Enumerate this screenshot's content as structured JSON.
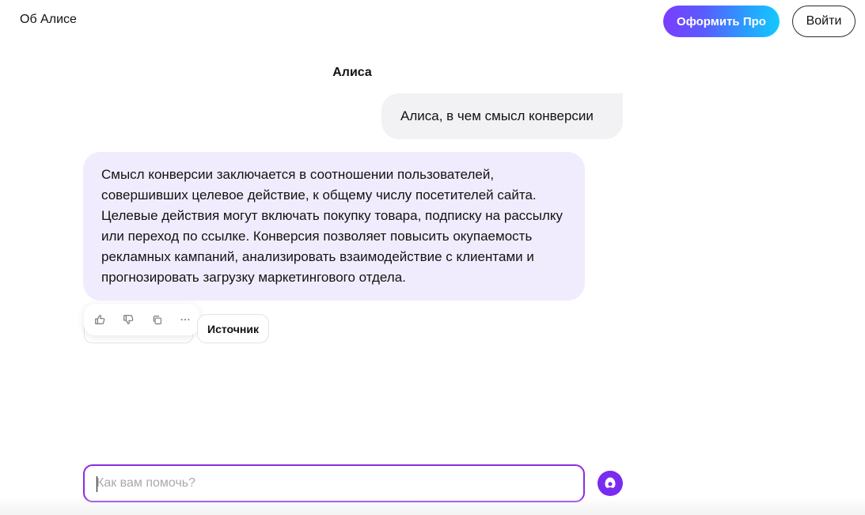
{
  "header": {
    "about_label": "Об Алисе",
    "pro_label": "Оформить Про",
    "login_label": "Войти"
  },
  "chat": {
    "title": "Алиса",
    "user_message": "Алиса, в чем смысл конверсии",
    "assistant_message": "Смысл конверсии заключается в соотношении пользователей, совершивших целевое действие, к общему числу посетителей сайта. Целевые действия могут включать покупку товара, подписку на рассылку или переход по ссылке. Конверсия позволяет повысить окупаемость рекламных кампаний, анализировать взаимодействие с клиентами и прогнозировать загрузку маркетингового отдела.",
    "actions": {
      "like_icon": "thumbs-up-icon",
      "dislike_icon": "thumbs-down-icon",
      "copy_icon": "copy-icon",
      "more_icon": "more-icon"
    },
    "source_label": "Источник"
  },
  "composer": {
    "placeholder": "Как вам помочь?",
    "value": ""
  },
  "colors": {
    "accent": "#7a2bf0",
    "assistant_bubble": "#f1ecfd",
    "user_bubble": "#f2f2f4"
  }
}
